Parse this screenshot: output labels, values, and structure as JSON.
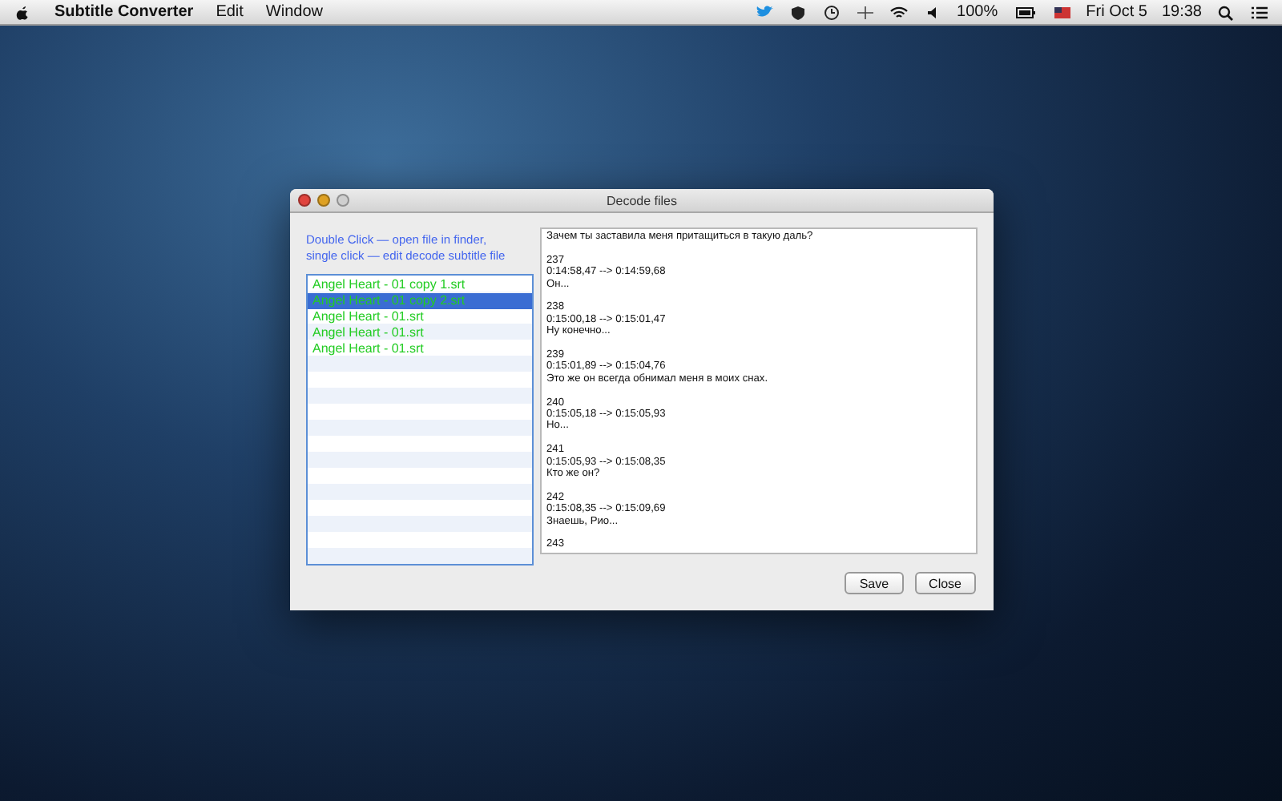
{
  "menu_bar": {
    "app_name": "Subtitle Converter",
    "menus": [
      "Edit",
      "Window"
    ],
    "battery": "100%",
    "date": "Fri Oct 5",
    "time": "19:38"
  },
  "window": {
    "title": "Decode files",
    "hint_lines": [
      "Double Click — open file in finder,",
      "single click — edit decode subtitle file"
    ],
    "files": [
      {
        "name": "Angel Heart - 01 copy 1.srt",
        "selected": false
      },
      {
        "name": "Angel Heart - 01 copy 2.srt",
        "selected": true
      },
      {
        "name": "Angel Heart - 01.srt",
        "selected": false
      },
      {
        "name": "Angel Heart - 01.srt",
        "selected": false
      },
      {
        "name": "Angel Heart - 01.srt",
        "selected": false
      }
    ],
    "subtitle_top_line": "Зачем ты заставила меня притащиться в такую даль?",
    "subtitles": [
      {
        "number": "237",
        "time": "0:14:58,47 --> 0:14:59,68",
        "text": "Он..."
      },
      {
        "number": "238",
        "time": "0:15:00,18 --> 0:15:01,47",
        "text": "Ну конечно..."
      },
      {
        "number": "239",
        "time": "0:15:01,89 --> 0:15:04,76",
        "text": "Это же он всегда обнимал меня в моих снах."
      },
      {
        "number": "240",
        "time": "0:15:05,18 --> 0:15:05,93",
        "text": "Но..."
      },
      {
        "number": "241",
        "time": "0:15:05,93 --> 0:15:08,35",
        "text": "Кто же он?"
      },
      {
        "number": "242",
        "time": "0:15:08,35 --> 0:15:09,69",
        "text": "Знаешь, Рио..."
      },
      {
        "number": "243"
      }
    ],
    "buttons": [
      "Save",
      "Close"
    ]
  }
}
